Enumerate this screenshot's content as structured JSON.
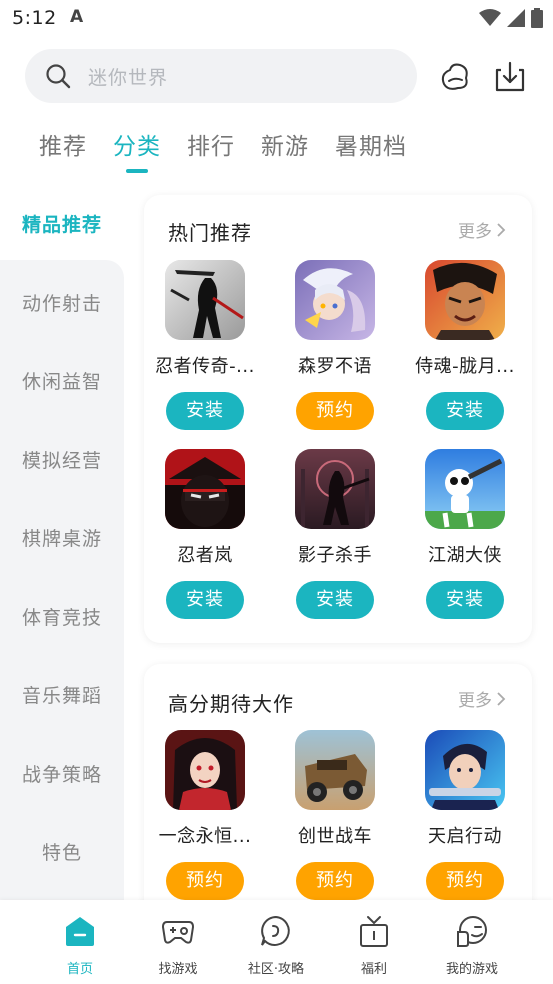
{
  "status_bar": {
    "time": "5:12",
    "app_glyph": "A"
  },
  "search": {
    "placeholder": "迷你世界"
  },
  "header_icons": [
    "sparkle-mascot-icon",
    "download-icon"
  ],
  "tabs": [
    {
      "label": "推荐"
    },
    {
      "label": "分类",
      "active": true
    },
    {
      "label": "排行"
    },
    {
      "label": "新游"
    },
    {
      "label": "暑期档"
    }
  ],
  "sidebar": {
    "items": [
      {
        "label": "精品推荐",
        "active": true
      },
      {
        "label": "动作射击"
      },
      {
        "label": "休闲益智"
      },
      {
        "label": "模拟经营"
      },
      {
        "label": "棋牌桌游"
      },
      {
        "label": "体育竞技"
      },
      {
        "label": "音乐舞蹈"
      },
      {
        "label": "战争策略"
      },
      {
        "label": "特色"
      }
    ]
  },
  "sections": [
    {
      "title": "热门推荐",
      "more": "更多",
      "games": [
        {
          "name": "忍者传奇-...",
          "action": "安装",
          "type": "install",
          "icon": "ninja-legend-icon"
        },
        {
          "name": "森罗不语",
          "action": "预约",
          "type": "reserve",
          "icon": "senluo-icon"
        },
        {
          "name": "侍魂-胧月...",
          "action": "安装",
          "type": "install",
          "icon": "samurai-icon"
        },
        {
          "name": "忍者岚",
          "action": "安装",
          "type": "install",
          "icon": "ninja-ran-icon"
        },
        {
          "name": "影子杀手",
          "action": "安装",
          "type": "install",
          "icon": "shadow-killer-icon"
        },
        {
          "name": "江湖大侠",
          "action": "安装",
          "type": "install",
          "icon": "jianghu-icon"
        }
      ]
    },
    {
      "title": "高分期待大作",
      "more": "更多",
      "games": [
        {
          "name": "一念永恒...",
          "action": "预约",
          "type": "reserve",
          "icon": "yinian-icon"
        },
        {
          "name": "创世战车",
          "action": "预约",
          "type": "reserve",
          "icon": "chuangshi-icon"
        },
        {
          "name": "天启行动",
          "action": "预约",
          "type": "reserve",
          "icon": "tianqi-icon"
        }
      ]
    }
  ],
  "bottom_nav": [
    {
      "label": "首页",
      "active": true,
      "icon": "home-icon"
    },
    {
      "label": "找游戏",
      "icon": "gamepad-search-icon"
    },
    {
      "label": "社区·攻略",
      "icon": "community-icon"
    },
    {
      "label": "福利",
      "icon": "gift-icon"
    },
    {
      "label": "我的游戏",
      "icon": "my-games-icon"
    }
  ],
  "colors": {
    "accent": "#1bb5c0",
    "reserve": "#ffa300",
    "sidebar_bg": "#f3f4f6"
  }
}
